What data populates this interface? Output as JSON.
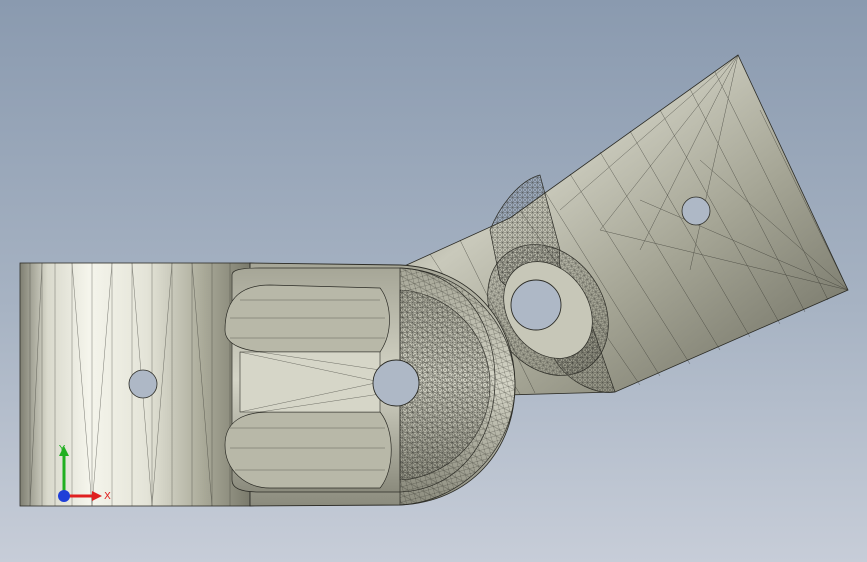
{
  "viewport": {
    "background_top": "#8a9aaf",
    "background_bottom": "#c7cdd8"
  },
  "model": {
    "type": "tessellated-3d-mesh",
    "shading": "flat-with-edges",
    "part_color": "#b9b9a8",
    "edge_color": "#2c2c26"
  },
  "triad": {
    "x_label": "X",
    "y_label": "Y",
    "x_color": "#e02020",
    "y_color": "#21b021",
    "z_color": "#1f3fd8"
  }
}
